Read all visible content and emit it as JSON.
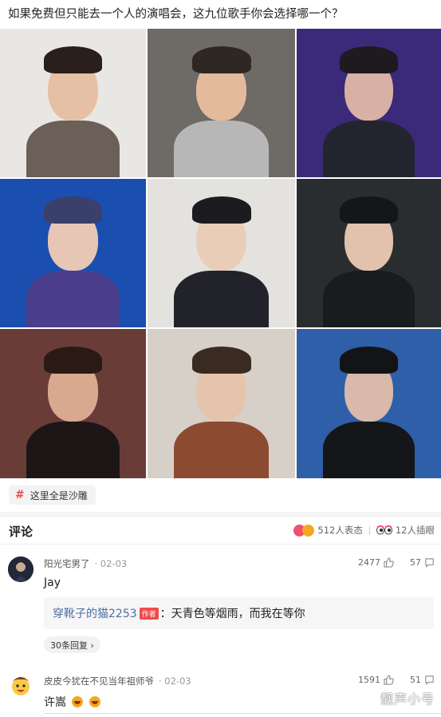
{
  "post": {
    "question": "如果免费但只能去一个人的演唱会，这九位歌手你会选择哪一个？"
  },
  "tag": {
    "symbol": "#",
    "label": "这里全是沙雕"
  },
  "comments_header": {
    "title": "评论",
    "reactions_label": "512人表态",
    "insert_label": "12人插眼"
  },
  "comments": [
    {
      "user": "阳光宅男了",
      "date": "· 02-03",
      "likes": "2477",
      "replies_count": "57",
      "text": "Jay",
      "reply": {
        "user": "穿靴子的猫2253",
        "badge": "作者",
        "text": "：天青色等烟雨，而我在等你"
      },
      "more_replies": "30条回复 ›"
    },
    {
      "user": "皮皮今犹在不见当年祖师爷",
      "date": "· 02-03",
      "likes": "1591",
      "replies_count": "51",
      "text": "许嵩"
    }
  ],
  "watermark": "靓声小号",
  "colors": {
    "accent_red": "#f04a4a",
    "reply_user_blue": "#4a6fa5",
    "bg_band": "#f4f4f4"
  },
  "photos": [
    {
      "bg": "#e9e7e4",
      "skin": "#e6c0a5",
      "hair": "#2a1f1a",
      "cloth": "#6b5f57"
    },
    {
      "bg": "#6e6a66",
      "skin": "#e3bb9c",
      "hair": "#2e2724",
      "cloth": "#b7b7b7"
    },
    {
      "bg": "#3b2a7a",
      "skin": "#d9b1a4",
      "hair": "#1e1a1f",
      "cloth": "#23252e"
    },
    {
      "bg": "#1a4fb0",
      "skin": "#e7c6b5",
      "hair": "#3a3f6b",
      "cloth": "#4a3e8d"
    },
    {
      "bg": "#e4e2df",
      "skin": "#e9cdb9",
      "hair": "#1c1c20",
      "cloth": "#22232a"
    },
    {
      "bg": "#2a2d30",
      "skin": "#e2c2ad",
      "hair": "#151618",
      "cloth": "#1a1b1f"
    },
    {
      "bg": "#6a3c38",
      "skin": "#d8a88f",
      "hair": "#2a1a16",
      "cloth": "#1c1716"
    },
    {
      "bg": "#d7d0c9",
      "skin": "#e6c4ac",
      "hair": "#3a2b22",
      "cloth": "#8c4b31"
    },
    {
      "bg": "#2f5fa8",
      "skin": "#d8b9aa",
      "hair": "#131416",
      "cloth": "#15161a"
    }
  ]
}
